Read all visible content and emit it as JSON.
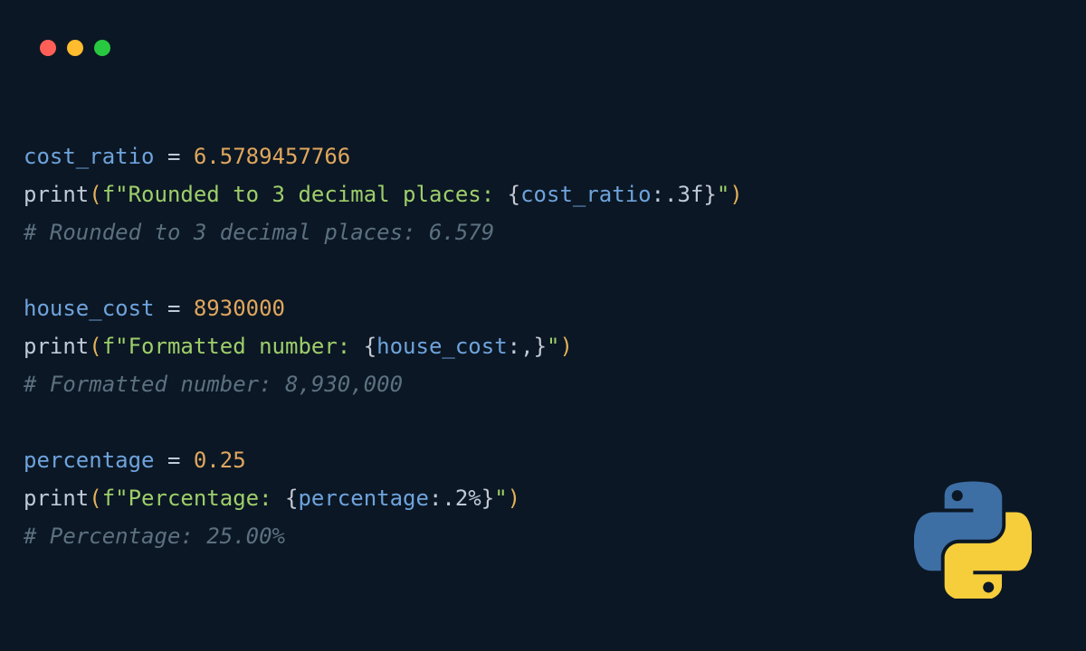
{
  "blocks": [
    {
      "assign_var": "cost_ratio",
      "assign_val": "6.5789457766",
      "print_label": "Rounded to 3 decimal places: ",
      "expr_var": "cost_ratio",
      "expr_fmt": ":.3f",
      "comment": "# Rounded to 3 decimal places: 6.579"
    },
    {
      "assign_var": "house_cost",
      "assign_val": "8930000",
      "print_label": "Formatted number: ",
      "expr_var": "house_cost",
      "expr_fmt": ":,",
      "comment": "# Formatted number: 8,930,000"
    },
    {
      "assign_var": "percentage",
      "assign_val": "0.25",
      "print_label": "Percentage: ",
      "expr_var": "percentage",
      "expr_fmt": ":.2%",
      "comment": "# Percentage: 25.00%"
    }
  ],
  "syntax": {
    "eq": " = ",
    "print": "print",
    "open": "(",
    "close": ")",
    "f": "f",
    "q": "\"",
    "lbrace": "{",
    "rbrace": "}"
  }
}
